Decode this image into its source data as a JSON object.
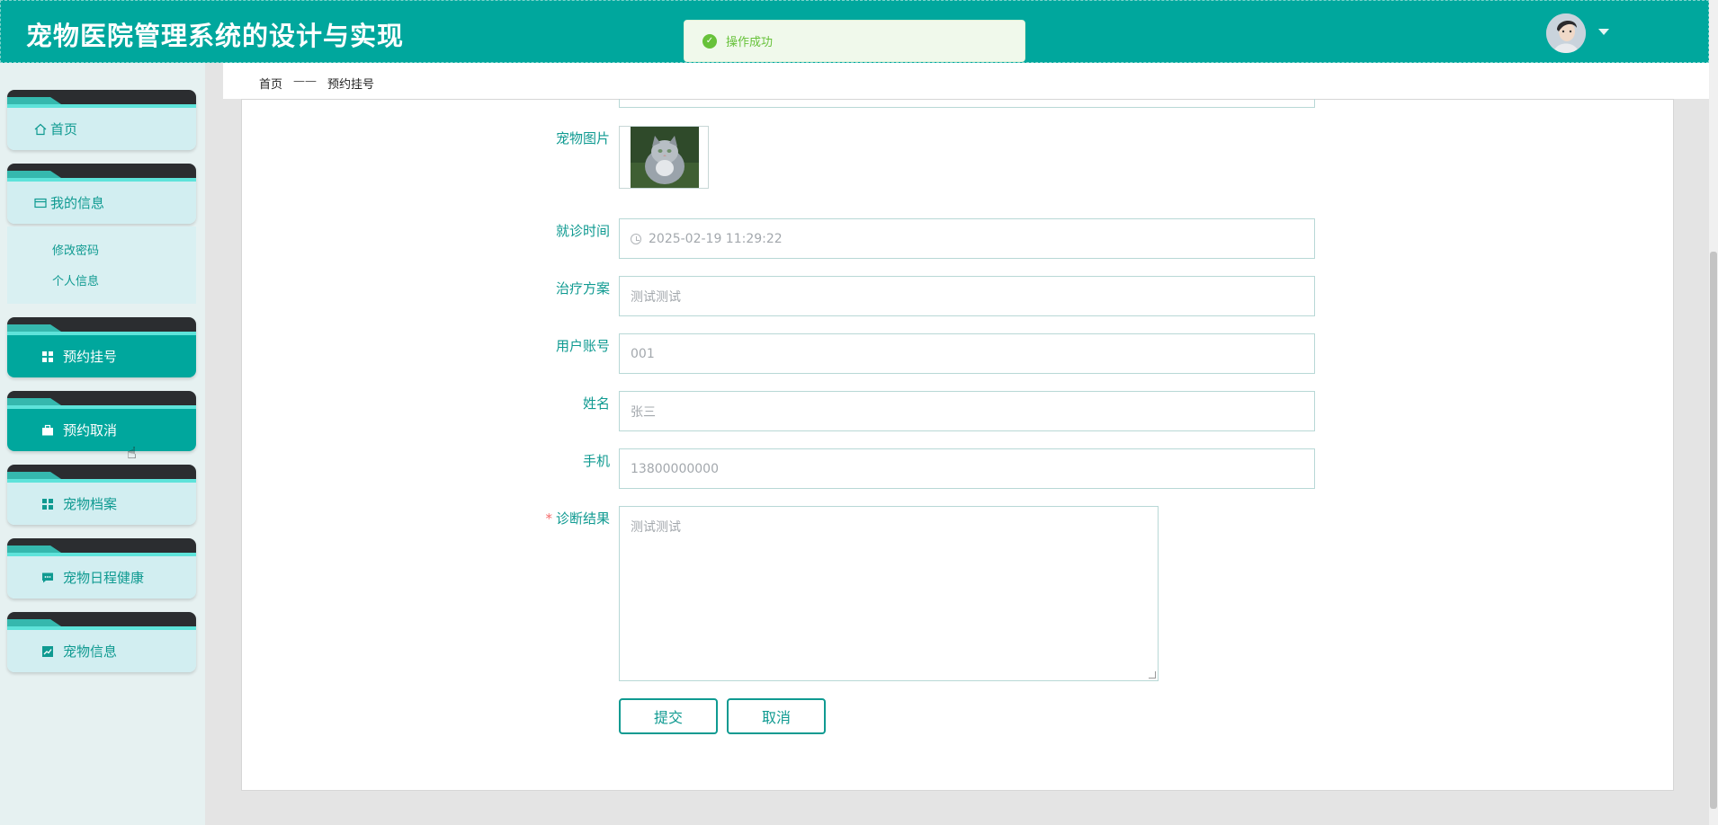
{
  "header": {
    "app_title": "宠物医院管理系统的设计与实现",
    "avatar_icon": "user-avatar",
    "dropdown_icon": "caret-down-icon"
  },
  "toast": {
    "icon": "check-circle-icon",
    "message": "操作成功",
    "color": "#67c23a"
  },
  "sidebar": {
    "items": [
      {
        "label": "首页",
        "icon": "home-icon"
      },
      {
        "label": "我的信息",
        "icon": "card-icon"
      },
      {
        "label": "预约挂号",
        "icon": "grid-icon",
        "active": true
      },
      {
        "label": "预约取消",
        "icon": "briefcase-icon",
        "active": true
      },
      {
        "label": "宠物档案",
        "icon": "grid-icon"
      },
      {
        "label": "宠物日程健康",
        "icon": "chat-icon"
      },
      {
        "label": "宠物信息",
        "icon": "chart-icon"
      }
    ],
    "submenu": [
      {
        "label": "修改密码"
      },
      {
        "label": "个人信息"
      }
    ]
  },
  "breadcrumb": {
    "home": "首页",
    "separator": "——",
    "current": "预约挂号"
  },
  "form": {
    "pet_image_label": "宠物图片",
    "visit_time_label": "就诊时间",
    "visit_time_value": "2025-02-19 11:29:22",
    "treatment_label": "治疗方案",
    "treatment_value": "测试测试",
    "account_label": "用户账号",
    "account_value": "001",
    "name_label": "姓名",
    "name_value": "张三",
    "phone_label": "手机",
    "phone_value": "13800000000",
    "diagnosis_required": "*",
    "diagnosis_label": "诊断结果",
    "diagnosis_value": "测试测试",
    "submit_label": "提交",
    "cancel_label": "取消"
  },
  "colors": {
    "brand": "#00a79d",
    "text_accent": "#0f9a91"
  }
}
